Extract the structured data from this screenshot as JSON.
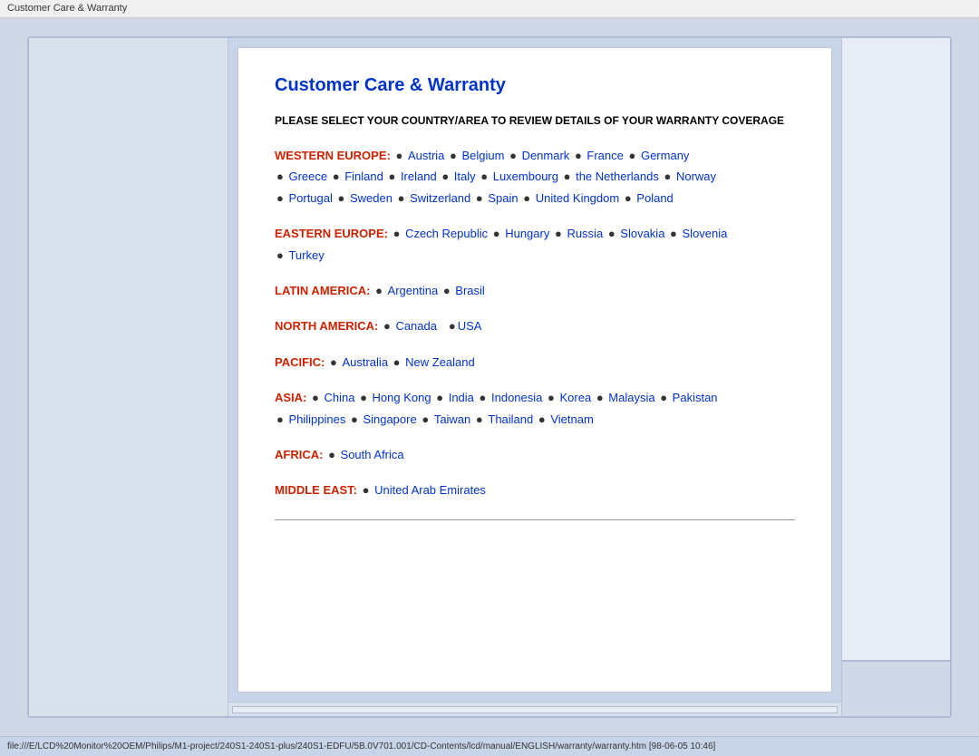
{
  "titleBar": {
    "text": "Customer Care & Warranty"
  },
  "page": {
    "title": "Customer Care & Warranty",
    "intro": "PLEASE SELECT YOUR COUNTRY/AREA TO REVIEW DETAILS OF YOUR WARRANTY COVERAGE",
    "regions": [
      {
        "id": "western-europe",
        "label": "WESTERN EUROPE:",
        "countries": [
          {
            "name": "Austria",
            "href": "#"
          },
          {
            "name": "Belgium",
            "href": "#"
          },
          {
            "name": "Denmark",
            "href": "#"
          },
          {
            "name": "France",
            "href": "#"
          },
          {
            "name": "Germany",
            "href": "#"
          },
          {
            "name": "Greece",
            "href": "#"
          },
          {
            "name": "Finland",
            "href": "#"
          },
          {
            "name": "Ireland",
            "href": "#"
          },
          {
            "name": "Italy",
            "href": "#"
          },
          {
            "name": "Luxembourg",
            "href": "#"
          },
          {
            "name": "the Netherlands",
            "href": "#"
          },
          {
            "name": "Norway",
            "href": "#"
          },
          {
            "name": "Portugal",
            "href": "#"
          },
          {
            "name": "Sweden",
            "href": "#"
          },
          {
            "name": "Switzerland",
            "href": "#"
          },
          {
            "name": "Spain",
            "href": "#"
          },
          {
            "name": "United Kingdom",
            "href": "#"
          },
          {
            "name": "Poland",
            "href": "#"
          }
        ]
      },
      {
        "id": "eastern-europe",
        "label": "EASTERN EUROPE:",
        "countries": [
          {
            "name": "Czech Republic",
            "href": "#"
          },
          {
            "name": "Hungary",
            "href": "#"
          },
          {
            "name": "Russia",
            "href": "#"
          },
          {
            "name": "Slovakia",
            "href": "#"
          },
          {
            "name": "Slovenia",
            "href": "#"
          },
          {
            "name": "Turkey",
            "href": "#"
          }
        ]
      },
      {
        "id": "latin-america",
        "label": "LATIN AMERICA:",
        "countries": [
          {
            "name": "Argentina",
            "href": "#"
          },
          {
            "name": "Brasil",
            "href": "#"
          }
        ]
      },
      {
        "id": "north-america",
        "label": "NORTH AMERICA:",
        "countries": [
          {
            "name": "Canada",
            "href": "#"
          },
          {
            "name": "USA",
            "href": "#"
          }
        ]
      },
      {
        "id": "pacific",
        "label": "PACIFIC:",
        "countries": [
          {
            "name": "Australia",
            "href": "#"
          },
          {
            "name": "New Zealand",
            "href": "#"
          }
        ]
      },
      {
        "id": "asia",
        "label": "ASIA:",
        "countries": [
          {
            "name": "China",
            "href": "#"
          },
          {
            "name": "Hong Kong",
            "href": "#"
          },
          {
            "name": "India",
            "href": "#"
          },
          {
            "name": "Indonesia",
            "href": "#"
          },
          {
            "name": "Korea",
            "href": "#"
          },
          {
            "name": "Malaysia",
            "href": "#"
          },
          {
            "name": "Pakistan",
            "href": "#"
          },
          {
            "name": "Philippines",
            "href": "#"
          },
          {
            "name": "Singapore",
            "href": "#"
          },
          {
            "name": "Taiwan",
            "href": "#"
          },
          {
            "name": "Thailand",
            "href": "#"
          },
          {
            "name": "Vietnam",
            "href": "#"
          }
        ]
      },
      {
        "id": "africa",
        "label": "AFRICA:",
        "countries": [
          {
            "name": "South Africa",
            "href": "#"
          }
        ]
      },
      {
        "id": "middle-east",
        "label": "MIDDLE EAST:",
        "countries": [
          {
            "name": "United Arab Emirates",
            "href": "#"
          }
        ]
      }
    ]
  },
  "bottomBar": {
    "text": "file:///E/LCD%20Monitor%20OEM/Philips/M1-project/240S1-240S1-plus/240S1-EDFU/5B.0V701.001/CD-Contents/lcd/manual/ENGLISH/warranty/warranty.htm [98-06-05 10:46]"
  }
}
